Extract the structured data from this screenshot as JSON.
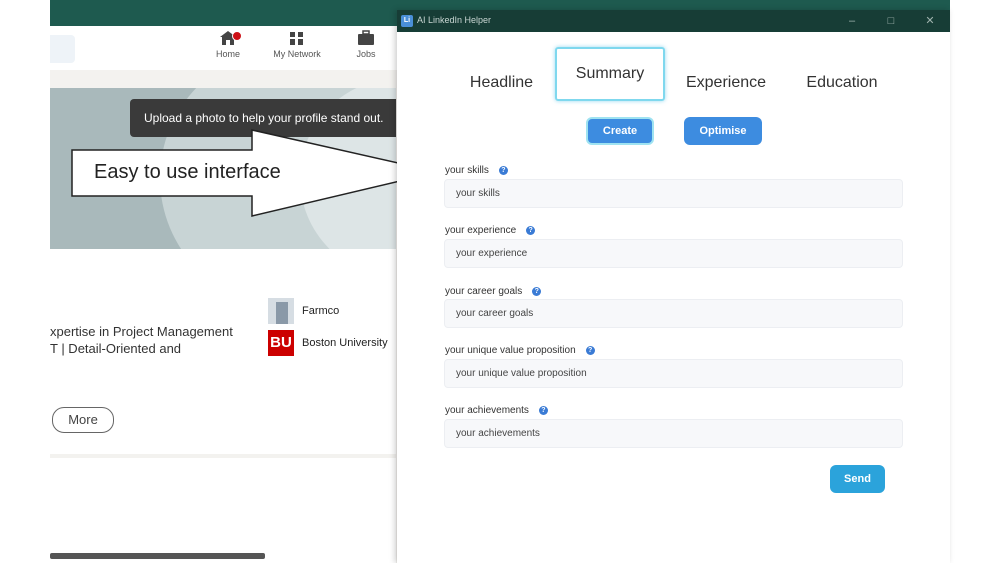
{
  "background_page": {
    "nav": [
      {
        "label": "Home",
        "icon": "home-icon"
      },
      {
        "label": "My Network",
        "icon": "network-icon"
      },
      {
        "label": "Jobs",
        "icon": "briefcase-icon"
      }
    ],
    "tooltip": "Upload a photo to help your profile stand out.",
    "profile_lines": [
      "xpertise in Project Management",
      "T | Detail-Oriented and"
    ],
    "experience_company": "Farmco",
    "education_school": "Boston University",
    "education_logo_text": "BU",
    "more_button": "More"
  },
  "callout": {
    "text": "Easy to use interface"
  },
  "app": {
    "title": "AI LinkedIn Helper",
    "logo_text": "Li",
    "tabs": [
      {
        "label": "Headline",
        "active": false
      },
      {
        "label": "Summary",
        "active": true
      },
      {
        "label": "Experience",
        "active": false
      },
      {
        "label": "Education",
        "active": false
      }
    ],
    "create_label": "Create",
    "optimise_label": "Optimise",
    "fields": [
      {
        "label": "your skills",
        "placeholder": "your skills"
      },
      {
        "label": "your experience",
        "placeholder": "your experience"
      },
      {
        "label": "your career goals",
        "placeholder": "your career goals"
      },
      {
        "label": "your unique value proposition",
        "placeholder": "your unique value proposition"
      },
      {
        "label": "your achievements",
        "placeholder": "your achievements"
      }
    ],
    "send_label": "Send",
    "colors": {
      "accent": "#3d8ce0",
      "send": "#2ba3db",
      "titlebar": "#173d36",
      "active_tab_border": "#7fd8ee"
    }
  }
}
